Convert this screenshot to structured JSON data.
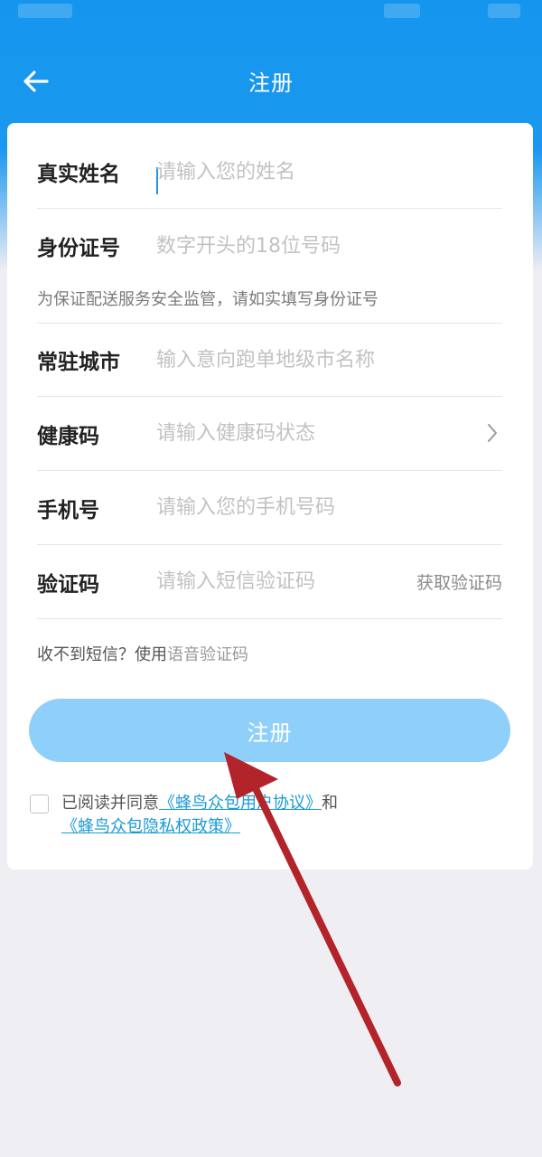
{
  "header": {
    "title": "注册"
  },
  "form": {
    "name": {
      "label": "真实姓名",
      "placeholder": "请输入您的姓名"
    },
    "id_card": {
      "label": "身份证号",
      "placeholder": "数字开头的18位号码",
      "hint": "为保证配送服务安全监管，请如实填写身份证号"
    },
    "city": {
      "label": "常驻城市",
      "placeholder": "输入意向跑单地级市名称"
    },
    "health_code": {
      "label": "健康码",
      "placeholder": "请输入健康码状态"
    },
    "phone": {
      "label": "手机号",
      "placeholder": "请输入您的手机号码"
    },
    "sms_code": {
      "label": "验证码",
      "placeholder": "请输入短信验证码",
      "get_code": "获取验证码"
    }
  },
  "voice": {
    "prefix": "收不到短信？使用",
    "link": "语音验证码"
  },
  "register_button": "注册",
  "agreement": {
    "prefix": "已阅读并同意",
    "link1": "《蜂鸟众包用户协议》",
    "middle": "和",
    "link2": "《蜂鸟众包隐私权政策》"
  },
  "colors": {
    "header_blue": "#1596ee",
    "button": "#8fd0fb",
    "link": "#1b9ad6",
    "annotation_arrow": "#b3232a"
  }
}
